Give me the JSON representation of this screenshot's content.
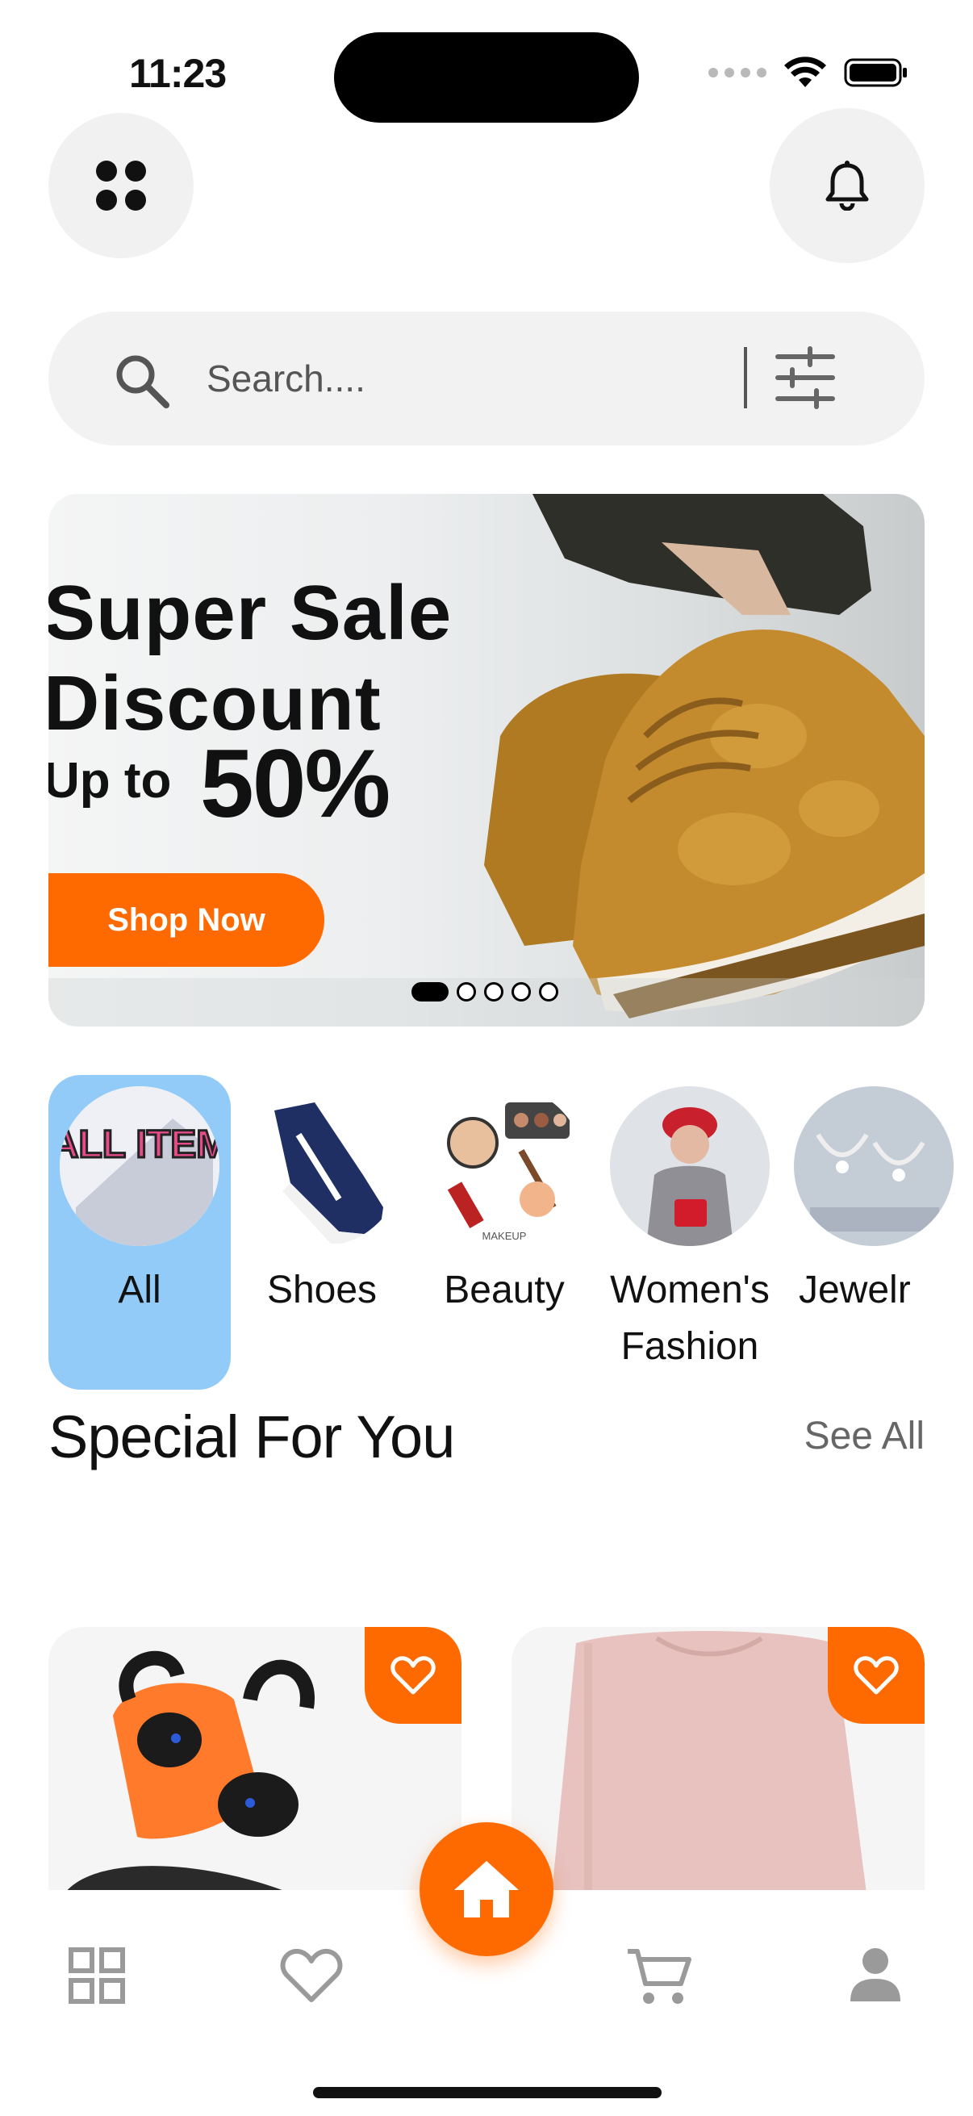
{
  "status_bar": {
    "time": "11:23"
  },
  "header": {
    "menu_icon": "grid-dots-icon",
    "notification_icon": "bell-icon"
  },
  "search": {
    "placeholder": "Search....",
    "search_icon": "search-icon",
    "filter_icon": "filter-sliders-icon"
  },
  "banner": {
    "title_line1": "Super Sale",
    "title_line2": "Discount",
    "upto_label": "Up to",
    "percent": "50%",
    "cta_label": "Shop Now",
    "slides_total": 5,
    "active_slide": 1
  },
  "categories": [
    {
      "label": "All",
      "selected": true,
      "thumb_text": "ALL ITEM"
    },
    {
      "label": "Shoes",
      "selected": false
    },
    {
      "label": "Beauty",
      "selected": false,
      "thumb_text": "MAKEUP"
    },
    {
      "label": "Women's Fashion",
      "selected": false
    },
    {
      "label": "Jewelr",
      "selected": false
    }
  ],
  "section": {
    "title": "Special For You",
    "see_all": "See All"
  },
  "products": [
    {
      "name": "wireless-earbuds",
      "favorite_icon": "heart-icon"
    },
    {
      "name": "pink-sweater",
      "favorite_icon": "heart-icon"
    }
  ],
  "tabbar": {
    "items": [
      "grid-icon",
      "heart-icon",
      "home-icon",
      "cart-icon",
      "profile-icon"
    ],
    "active": "home-icon"
  },
  "colors": {
    "accent": "#ff6a00",
    "selected_category": "#93cbf8",
    "surface": "#f2f2f2"
  }
}
